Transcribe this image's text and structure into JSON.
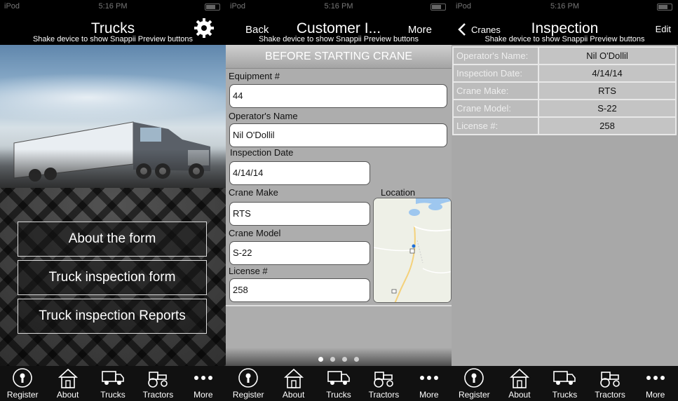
{
  "status_bar": {
    "carrier": "iPod",
    "time": "5:16 PM"
  },
  "shake_hint": "Shake device to show Snappii Preview buttons",
  "tabs": [
    {
      "label": "Register",
      "icon": "keyhole-icon"
    },
    {
      "label": "About",
      "icon": "house-icon"
    },
    {
      "label": "Trucks",
      "icon": "truck-icon"
    },
    {
      "label": "Tractors",
      "icon": "tractor-icon"
    },
    {
      "label": "More",
      "icon": "more-dots-icon"
    }
  ],
  "panel1": {
    "title": "Trucks",
    "settings_icon": "gear-icon",
    "buttons": [
      "About the form",
      "Truck inspection form",
      "Truck inspection Reports"
    ]
  },
  "panel2": {
    "back": "Back",
    "title": "Customer I...",
    "more": "More",
    "section_header": "BEFORE STARTING CRANE",
    "fields": [
      {
        "label": "Equipment #",
        "value": "44"
      },
      {
        "label": "Operator's Name",
        "value": "Nil O'Dollil"
      },
      {
        "label": "Inspection Date",
        "value": "4/14/14"
      },
      {
        "label": "Crane Make",
        "value": "RTS"
      },
      {
        "label": "Crane Model",
        "value": "S-22"
      },
      {
        "label": "License #",
        "value": "258"
      }
    ],
    "location_label": "Location",
    "page_dots": {
      "total": 4,
      "active": 0
    }
  },
  "panel3": {
    "back": "Cranes",
    "title": "Inspection",
    "edit": "Edit",
    "rows": [
      {
        "key": "Operator's Name:",
        "value": "Nil O'Dollil"
      },
      {
        "key": "Inspection Date:",
        "value": "4/14/14"
      },
      {
        "key": "Crane Make:",
        "value": "RTS"
      },
      {
        "key": "Crane Model:",
        "value": "S-22"
      },
      {
        "key": "License #:",
        "value": "258"
      }
    ]
  },
  "colors": {
    "bar_bg": "#000000",
    "tab_bg": "#111111",
    "form_bg": "#adadad",
    "detail_bg": "#a8a8a8"
  }
}
